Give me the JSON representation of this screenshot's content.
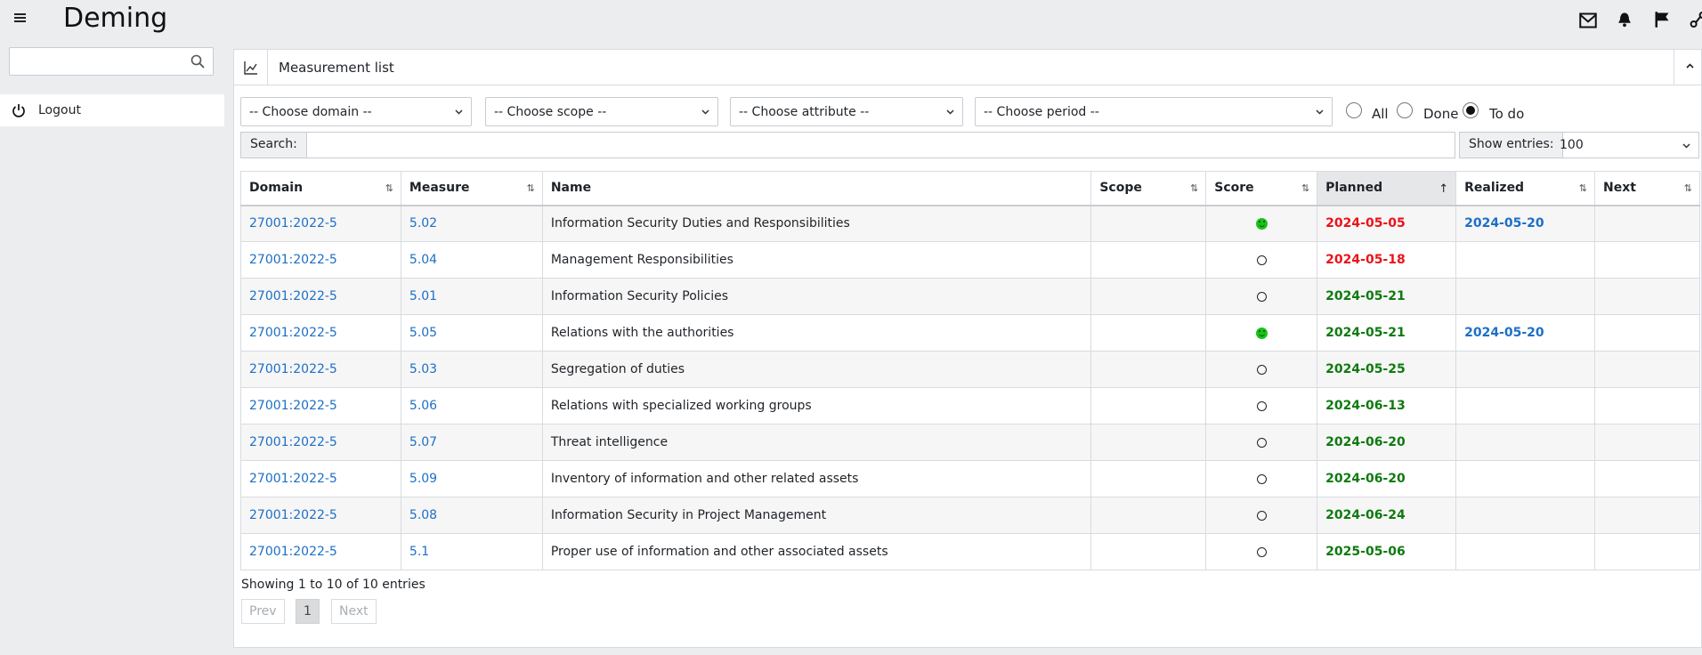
{
  "app": {
    "title": "Deming"
  },
  "sidebar": {
    "search_placeholder": "",
    "logout_label": "Logout"
  },
  "card": {
    "title": "Measurement list"
  },
  "filters": {
    "domain": "-- Choose domain --",
    "scope": "-- Choose scope --",
    "attribute": "-- Choose attribute --",
    "period": "-- Choose period --",
    "radios": [
      {
        "label": "All",
        "checked": false
      },
      {
        "label": "Done",
        "checked": false
      },
      {
        "label": "To do",
        "checked": true
      }
    ]
  },
  "table_controls": {
    "search_label": "Search:",
    "entries_label": "Show entries:",
    "entries_value": "100"
  },
  "columns": [
    "Domain",
    "Measure",
    "Name",
    "Scope",
    "Score",
    "Planned",
    "Realized",
    "Next"
  ],
  "rows": [
    {
      "domain": "27001:2022-5",
      "measure": "5.02",
      "name": "Information Security Duties and Responsibilities",
      "scope": "",
      "score": "smile",
      "planned": "2024-05-05",
      "planned_color": "#e8141b",
      "realized": "2024-05-20",
      "next": ""
    },
    {
      "domain": "27001:2022-5",
      "measure": "5.04",
      "name": "Management Responsibilities",
      "scope": "",
      "score": "circle",
      "planned": "2024-05-18",
      "planned_color": "#e8141b",
      "realized": "",
      "next": ""
    },
    {
      "domain": "27001:2022-5",
      "measure": "5.01",
      "name": "Information Security Policies",
      "scope": "",
      "score": "circle",
      "planned": "2024-05-21",
      "planned_color": "#0f7a0f",
      "realized": "",
      "next": ""
    },
    {
      "domain": "27001:2022-5",
      "measure": "5.05",
      "name": "Relations with the authorities",
      "scope": "",
      "score": "smile",
      "planned": "2024-05-21",
      "planned_color": "#0f7a0f",
      "realized": "2024-05-20",
      "next": ""
    },
    {
      "domain": "27001:2022-5",
      "measure": "5.03",
      "name": "Segregation of duties",
      "scope": "",
      "score": "circle",
      "planned": "2024-05-25",
      "planned_color": "#0f7a0f",
      "realized": "",
      "next": ""
    },
    {
      "domain": "27001:2022-5",
      "measure": "5.06",
      "name": "Relations with specialized working groups",
      "scope": "",
      "score": "circle",
      "planned": "2024-06-13",
      "planned_color": "#0f7a0f",
      "realized": "",
      "next": ""
    },
    {
      "domain": "27001:2022-5",
      "measure": "5.07",
      "name": "Threat intelligence",
      "scope": "",
      "score": "circle",
      "planned": "2024-06-20",
      "planned_color": "#0f7a0f",
      "realized": "",
      "next": ""
    },
    {
      "domain": "27001:2022-5",
      "measure": "5.09",
      "name": "Inventory of information and other related assets",
      "scope": "",
      "score": "circle",
      "planned": "2024-06-20",
      "planned_color": "#0f7a0f",
      "realized": "",
      "next": ""
    },
    {
      "domain": "27001:2022-5",
      "measure": "5.08",
      "name": "Information Security in Project Management",
      "scope": "",
      "score": "circle",
      "planned": "2024-06-24",
      "planned_color": "#0f7a0f",
      "realized": "",
      "next": ""
    },
    {
      "domain": "27001:2022-5",
      "measure": "5.1",
      "name": "Proper use of information and other associated assets",
      "scope": "",
      "score": "circle",
      "planned": "2025-05-06",
      "planned_color": "#0f7a0f",
      "realized": "",
      "next": ""
    }
  ],
  "footer": {
    "info": "Showing 1 to 10 of 10 entries",
    "prev": "Prev",
    "page": "1",
    "next": "Next"
  },
  "icons": {
    "header": [
      "mail-icon",
      "bell-icon",
      "flag-icon",
      "network-icon"
    ],
    "score_done": "smile-icon",
    "score_pending": "circle-icon"
  }
}
